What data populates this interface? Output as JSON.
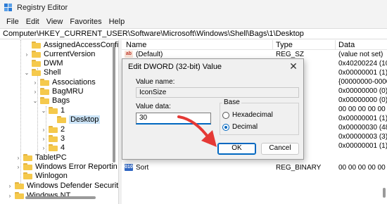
{
  "window": {
    "title": "Registry Editor"
  },
  "menu": [
    "File",
    "Edit",
    "View",
    "Favorites",
    "Help"
  ],
  "address": "Computer\\HKEY_CURRENT_USER\\Software\\Microsoft\\Windows\\Shell\\Bags\\1\\Desktop",
  "tree": [
    {
      "label": "AssignedAccessConfigu",
      "chevron": ""
    },
    {
      "label": "CurrentVersion",
      "chevron": "›"
    },
    {
      "label": "DWM",
      "chevron": ""
    },
    {
      "label": "Shell",
      "chevron": "⌄"
    },
    {
      "label": "Associations",
      "chevron": "›"
    },
    {
      "label": "BagMRU",
      "chevron": "›"
    },
    {
      "label": "Bags",
      "chevron": "⌄"
    },
    {
      "label": "1",
      "chevron": "⌄"
    },
    {
      "label": "Desktop",
      "chevron": ""
    },
    {
      "label": "2",
      "chevron": "›"
    },
    {
      "label": "3",
      "chevron": "›"
    },
    {
      "label": "4",
      "chevron": "›"
    },
    {
      "label": "TabletPC",
      "chevron": "›"
    },
    {
      "label": "Windows Error Reportin",
      "chevron": "›"
    },
    {
      "label": "Winlogon",
      "chevron": ""
    },
    {
      "label": "Windows Defender Securit",
      "chevron": "›"
    },
    {
      "label": "Windows NT",
      "chevron": "›"
    }
  ],
  "columns": {
    "name": "Name",
    "type": "Type",
    "data": "Data"
  },
  "rows": [
    {
      "name": "(Default)",
      "type": "REG_SZ",
      "data": "(value not set)",
      "icon": "ab"
    },
    {
      "name": "",
      "type": "RD",
      "data": "0x40200224 (1075",
      "icon": "bin"
    },
    {
      "name": "",
      "type": "RD",
      "data": "0x00000001 (1)",
      "icon": "bin"
    },
    {
      "name": "",
      "type": "",
      "data": "{00000000-0000-0",
      "icon": "ab"
    },
    {
      "name": "",
      "type": "RD",
      "data": "0x00000000 (0)",
      "icon": "bin"
    },
    {
      "name": "",
      "type": "RD",
      "data": "0x00000000 (0)",
      "icon": "bin"
    },
    {
      "name": "",
      "type": "BINARY",
      "data": "00 00 00 00 00 00",
      "icon": "bin"
    },
    {
      "name": "",
      "type": "RD",
      "data": "0x00000001 (1)",
      "icon": "bin"
    },
    {
      "name": "",
      "type": "RD",
      "data": "0x00000030 (48)",
      "icon": "bin"
    },
    {
      "name": "",
      "type": "RD",
      "data": "0x00000003 (3)",
      "icon": "bin"
    },
    {
      "name": "",
      "type": "RD",
      "data": "0x00000001 (1)",
      "icon": "bin"
    },
    {
      "name": "Sort",
      "type": "REG_BINARY",
      "data": "00 00 00 00 00 00",
      "icon": "bin"
    }
  ],
  "dialog": {
    "title": "Edit DWORD (32-bit) Value",
    "value_name_label": "Value name:",
    "value_name": "IconSize",
    "value_data_label": "Value data:",
    "value_data": "30",
    "base_label": "Base",
    "hex_label": "Hexadecimal",
    "dec_label": "Decimal",
    "selected_base": "Decimal",
    "ok_label": "OK",
    "cancel_label": "Cancel",
    "close_glyph": "✕"
  },
  "colors": {
    "accent": "#0067c0",
    "annotation_arrow": "#e53935",
    "selection": "#cce4f7"
  },
  "icons": {
    "string_value": "ab",
    "binary_value": "010"
  }
}
